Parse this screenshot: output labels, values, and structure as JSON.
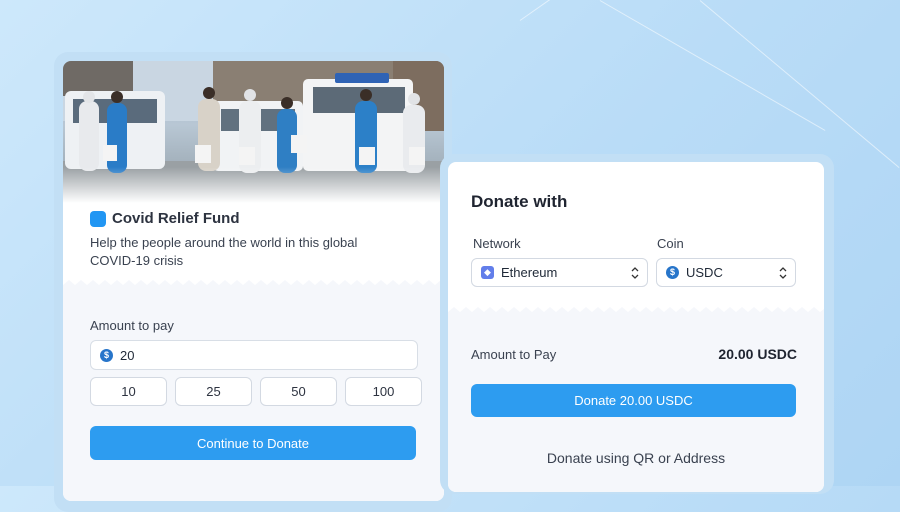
{
  "campaign": {
    "title": "Covid Relief Fund",
    "description": "Help the people around the world in this global COVID-19 crisis",
    "logo_color": "#2196f3"
  },
  "amount_form": {
    "label": "Amount to pay",
    "input_value": "20",
    "currency_icon": "usdc-icon",
    "presets": [
      "10",
      "25",
      "50",
      "100"
    ],
    "continue_label": "Continue to Donate"
  },
  "donate_panel": {
    "title": "Donate with",
    "network_label": "Network",
    "network_value": "Ethereum",
    "network_icon": "ethereum-icon",
    "coin_label": "Coin",
    "coin_value": "USDC",
    "coin_icon": "usdc-icon",
    "amount_label": "Amount to Pay",
    "amount_value": "20.00 USDC",
    "donate_label": "Donate 20.00 USDC",
    "qr_link_label": "Donate using QR or Address"
  },
  "colors": {
    "primary_button": "#2d9cf0",
    "background": "#cde8fb",
    "usdc": "#2775ca",
    "ethereum": "#627eea"
  }
}
